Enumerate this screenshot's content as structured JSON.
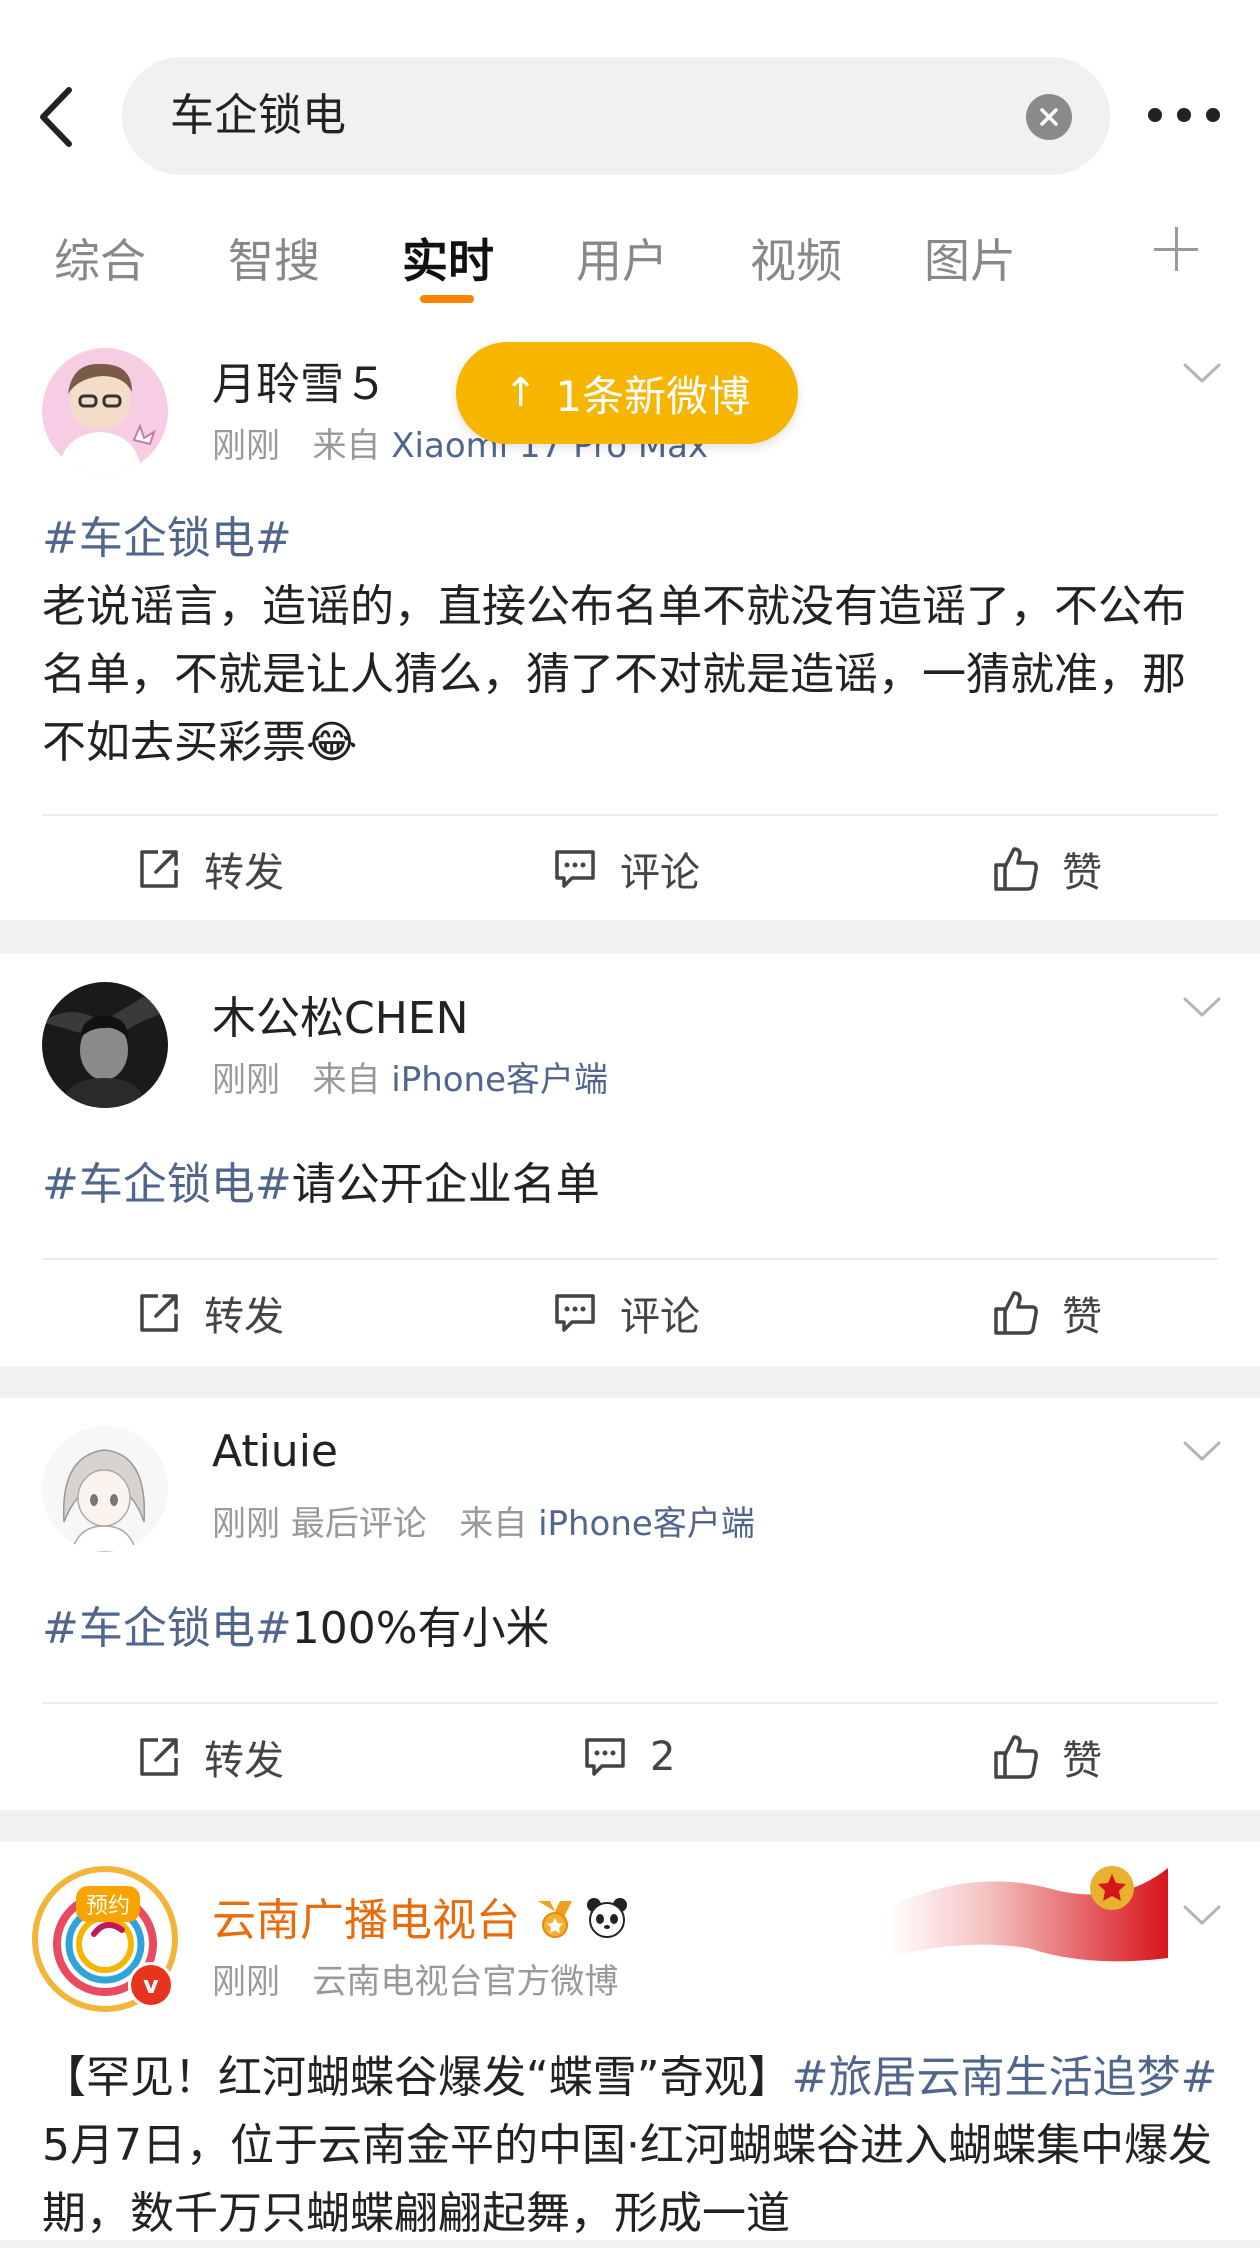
{
  "search": {
    "query": "车企锁电"
  },
  "tabs": [
    {
      "label": "综合"
    },
    {
      "label": "智搜"
    },
    {
      "label": "实时"
    },
    {
      "label": "用户"
    },
    {
      "label": "视频"
    },
    {
      "label": "图片"
    }
  ],
  "new_posts_banner": "1条新微博",
  "posts": [
    {
      "author": "月聆雪５",
      "time": "刚刚",
      "source_prefix": "来自",
      "source": "Xiaomi 17 Pro Max",
      "hashtag": "#车企锁电#",
      "text": "老说谣言，造谣的，直接公布名单不就没有造谣了，不公布名单，不就是让人猜么，猜了不对就是造谣，一猜就准，那不如去买彩票😂",
      "repost": "转发",
      "comment": "评论",
      "like": "赞"
    },
    {
      "author": "木公松CHEN",
      "time": "刚刚",
      "source_prefix": "来自",
      "source": "iPhone客户端",
      "hashtag": "#车企锁电#",
      "text": "请公开企业名单",
      "repost": "转发",
      "comment": "评论",
      "like": "赞"
    },
    {
      "author": "Atiuie",
      "time": "刚刚",
      "extra": "最后评论",
      "source_prefix": "来自",
      "source": "iPhone客户端",
      "hashtag": "#车企锁电#",
      "text": "100%有小米",
      "repost": "转发",
      "comment": "2",
      "like": "赞"
    },
    {
      "author": "云南广播电视台",
      "avatar_badge": "预约",
      "time": "刚刚",
      "source": "云南电视台官方微博",
      "headline": "【罕见！红河蝴蝶谷爆发“蝶雪”奇观】",
      "hashtag": "#旅居云南生活追梦#",
      "text": " 5月7日，位于云南金平的中国·红河蝴蝶谷进入蝴蝶集中爆发期，数千万只蝴蝶翩翩起舞，形成一道"
    }
  ],
  "colors": {
    "accent": "#ff8200",
    "link": "#50668d",
    "pill": "#f7b500",
    "verified": "#e8341c"
  }
}
